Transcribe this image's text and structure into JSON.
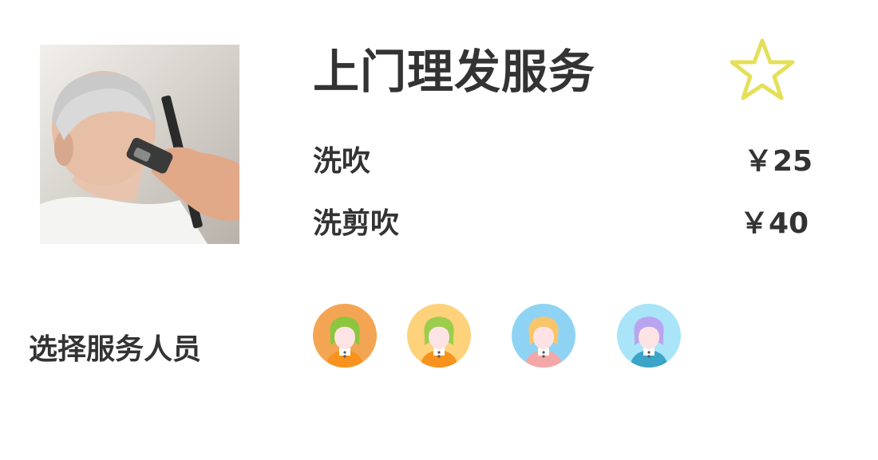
{
  "service": {
    "title": "上门理发服务",
    "photo_icon": "haircut-photo",
    "favorite_icon": "star-outline-icon",
    "favorite_color": "#e4e05a"
  },
  "options": [
    {
      "name": "洗吹",
      "price": "￥25"
    },
    {
      "name": "洗剪吹",
      "price": "￥40"
    }
  ],
  "staff": {
    "label": "选择服务人员",
    "avatars": [
      {
        "bg": "#f4a553",
        "hair": "#8cc63f",
        "shirt": "#f7931e"
      },
      {
        "bg": "#fdd27a",
        "hair": "#9ccd4c",
        "shirt": "#f7931e"
      },
      {
        "bg": "#8fd3f4",
        "hair": "#f8c56b",
        "shirt": "#f4a7a7"
      },
      {
        "bg": "#a9e4f8",
        "hair": "#b9a4f0",
        "shirt": "#3ba4c8"
      }
    ]
  }
}
